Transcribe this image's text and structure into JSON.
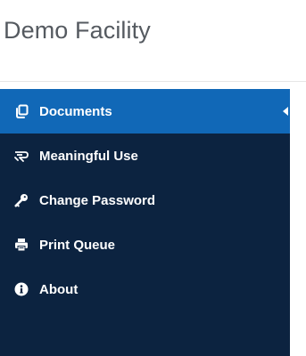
{
  "header": {
    "title": "Demo Facility"
  },
  "sidebar": {
    "items": [
      {
        "label": "Documents",
        "icon": "documents-icon",
        "active": true
      },
      {
        "label": "Meaningful Use",
        "icon": "meaningful-use-icon",
        "active": false
      },
      {
        "label": "Change Password",
        "icon": "key-icon",
        "active": false
      },
      {
        "label": "Print Queue",
        "icon": "printer-icon",
        "active": false
      },
      {
        "label": "About",
        "icon": "info-icon",
        "active": false
      }
    ]
  },
  "colors": {
    "sidebar_background": "#0c2340",
    "active_item_background": "#1168b7",
    "title_text": "#555a60"
  }
}
